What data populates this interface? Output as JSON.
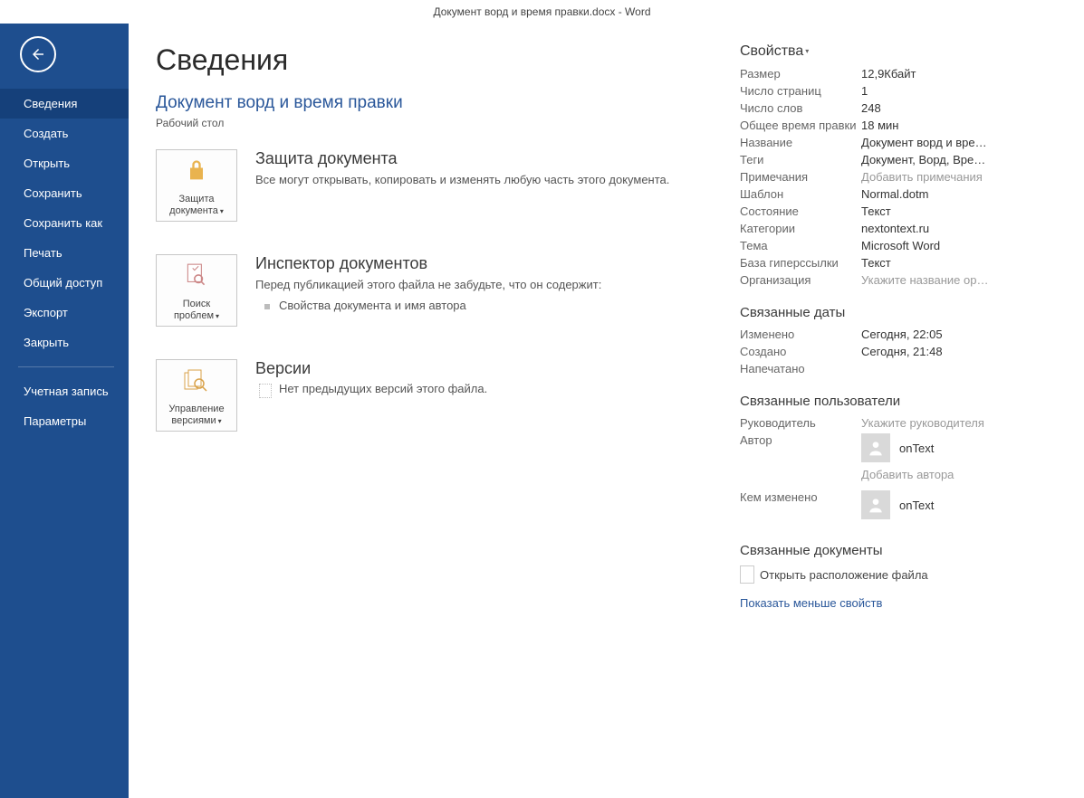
{
  "titlebar": "Документ ворд и время правки.docx - Word",
  "sidebar": {
    "items": [
      "Сведения",
      "Создать",
      "Открыть",
      "Сохранить",
      "Сохранить как",
      "Печать",
      "Общий доступ",
      "Экспорт",
      "Закрыть"
    ],
    "bottom_items": [
      "Учетная запись",
      "Параметры"
    ],
    "selected_index": 0
  },
  "page": {
    "title": "Сведения",
    "doc_title": "Документ ворд и время правки",
    "doc_location": "Рабочий стол"
  },
  "protect": {
    "tile_label": "Защита документа",
    "heading": "Защита документа",
    "desc": "Все могут открывать, копировать и изменять любую часть этого документа."
  },
  "inspect": {
    "tile_label": "Поиск проблем",
    "heading": "Инспектор документов",
    "desc": "Перед публикацией этого файла не забудьте, что он содержит:",
    "bullets": [
      "Свойства документа и имя автора"
    ]
  },
  "versions": {
    "tile_label": "Управление версиями",
    "heading": "Версии",
    "empty": "Нет предыдущих версий этого файла."
  },
  "props": {
    "heading": "Свойства",
    "rows": {
      "size_label": "Размер",
      "size_value": "12,9Кбайт",
      "pages_label": "Число страниц",
      "pages_value": "1",
      "words_label": "Число слов",
      "words_value": "248",
      "edit_time_label": "Общее время правки",
      "edit_time_value": "18 мин",
      "name_label": "Название",
      "name_value": "Документ ворд и вре…",
      "tags_label": "Теги",
      "tags_value": "Документ, Ворд, Вре…",
      "comments_label": "Примечания",
      "comments_value": "Добавить примечания",
      "template_label": "Шаблон",
      "template_value": "Normal.dotm",
      "status_label": "Состояние",
      "status_value": "Текст",
      "categories_label": "Категории",
      "categories_value": "nextontext.ru",
      "theme_label": "Тема",
      "theme_value": "Microsoft Word",
      "hyperlink_label": "База гиперссылки",
      "hyperlink_value": "Текст",
      "org_label": "Организация",
      "org_value": "Укажите название ор…"
    },
    "dates_heading": "Связанные даты",
    "dates": {
      "modified_label": "Изменено",
      "modified_value": "Сегодня, 22:05",
      "created_label": "Создано",
      "created_value": "Сегодня, 21:48",
      "printed_label": "Напечатано",
      "printed_value": ""
    },
    "people_heading": "Связанные пользователи",
    "people": {
      "manager_label": "Руководитель",
      "manager_placeholder": "Укажите руководителя",
      "author_label": "Автор",
      "author_name": "onText",
      "add_author": "Добавить автора",
      "lastmod_label": "Кем изменено",
      "lastmod_name": "onText"
    },
    "docs_heading": "Связанные документы",
    "open_location": "Открыть расположение файла",
    "fewer_props": "Показать меньше свойств"
  }
}
